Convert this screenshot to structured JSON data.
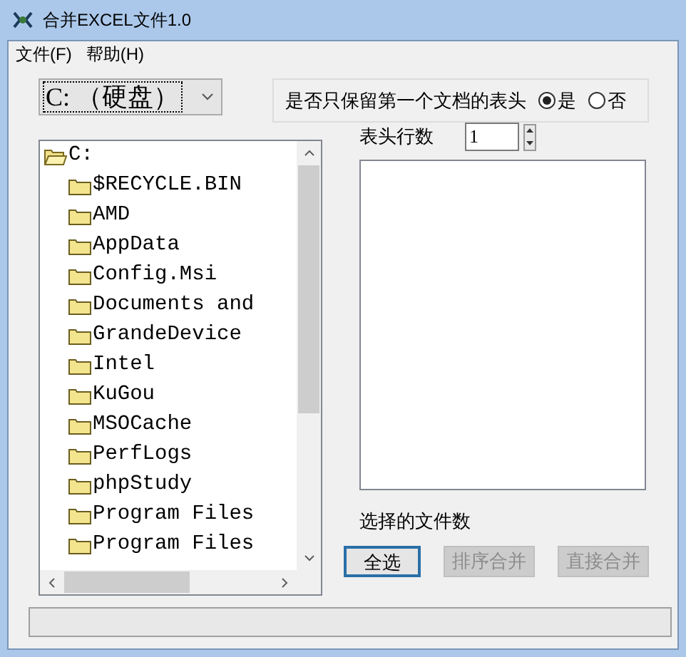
{
  "window": {
    "title": "合并EXCEL文件1.0"
  },
  "menu": [
    "文件(F)",
    "帮助(H)"
  ],
  "drive_combo": {
    "value": "C: （硬盘）"
  },
  "header_option": {
    "label": "是否只保留第一个文档的表头",
    "options": [
      {
        "label": "是",
        "selected": true
      },
      {
        "label": "否",
        "selected": false
      }
    ]
  },
  "tree": {
    "label": "C:",
    "expanded": true,
    "children": [
      {
        "label": "$RECYCLE.BIN"
      },
      {
        "label": "AMD"
      },
      {
        "label": "AppData"
      },
      {
        "label": "Config.Msi"
      },
      {
        "label": "Documents and"
      },
      {
        "label": "GrandeDevice"
      },
      {
        "label": "Intel"
      },
      {
        "label": "KuGou"
      },
      {
        "label": "MSOCache"
      },
      {
        "label": "PerfLogs"
      },
      {
        "label": "phpStudy"
      },
      {
        "label": "Program Files"
      },
      {
        "label": "Program Files"
      }
    ]
  },
  "header_rows": {
    "label": "表头行数",
    "value": "1"
  },
  "selected_count_label": "选择的文件数",
  "buttons": [
    {
      "label": "全选",
      "disabled": false,
      "focused": true
    },
    {
      "label": "排序合并",
      "disabled": true,
      "focused": false
    },
    {
      "label": "直接合并",
      "disabled": true,
      "focused": false
    }
  ]
}
